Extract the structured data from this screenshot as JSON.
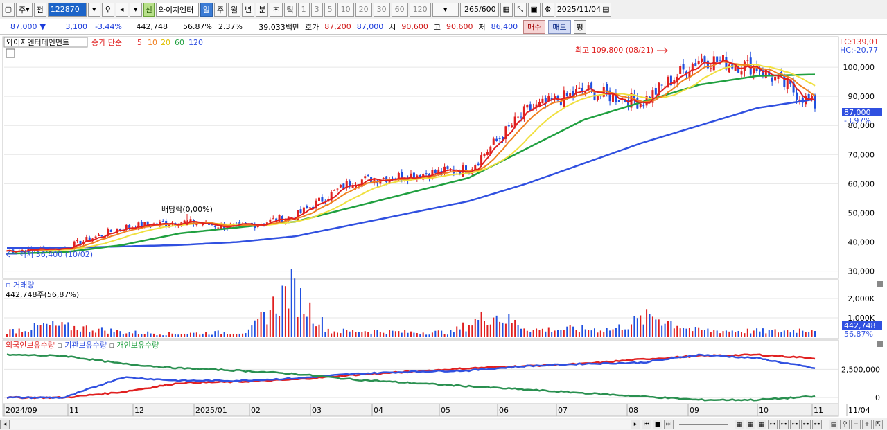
{
  "toolbar": {
    "period_label": "주",
    "prev_label": "전",
    "stock_code": "122870",
    "shin_label": "신",
    "stock_name": "와이지엔터",
    "intervals": [
      "일",
      "주",
      "월",
      "년",
      "분",
      "초",
      "틱"
    ],
    "active_interval": "일",
    "minutes": [
      "1",
      "3",
      "5",
      "10",
      "20",
      "30",
      "60",
      "120"
    ],
    "count_display": "265",
    "count_total": "/600",
    "date": "2025/11/04"
  },
  "quote": {
    "price": "87,000",
    "change": "3,100",
    "change_pct": "-3.44%",
    "volume": "442,748",
    "volume_ratio": "56.87%",
    "turnover_pct": "2.37%",
    "value": "39,033백만",
    "bid_label": "호가",
    "bid": "87,200",
    "ask": "87,000",
    "open_label": "시",
    "open": "90,600",
    "high_label": "고",
    "high": "90,600",
    "low_label": "저",
    "low": "86,400",
    "buy_button": "매수",
    "sell_button": "매도",
    "eval_button": "평"
  },
  "price_panel": {
    "stock_label": "와이지엔터테인먼트",
    "ma_label": "종가 단순",
    "ma_periods": [
      "5",
      "10",
      "20",
      "60",
      "120"
    ],
    "lc_label": "LC:139,01",
    "hc_label": "HC:-20,77",
    "high_annotation": "최고 109,800 (08/21)",
    "low_annotation": "최저 36,400 (10/02)",
    "dividend_annotation": "배당락(0,00%)",
    "current_price_tag": "87,000",
    "current_change_tag": "-3,97%"
  },
  "volume_panel": {
    "title": "거래량",
    "summary": "442,748주(56,87%)",
    "current_tag": "442,748",
    "current_ratio_tag": "56,87%"
  },
  "holding_panel": {
    "series": [
      "외국인보유수량",
      "기관보유수량",
      "개인보유수량"
    ]
  },
  "x_axis_labels": [
    "2024/09",
    "11",
    "12",
    "2025/01",
    "02",
    "03",
    "04",
    "05",
    "06",
    "07",
    "08",
    "09",
    "10",
    "11",
    "11/04"
  ],
  "colors": {
    "ma5": "#e02020",
    "ma10": "#f08020",
    "ma20": "#f0e040",
    "ma60": "#20a040",
    "ma120": "#3050e0",
    "candle_up": "#e02020",
    "candle_down": "#2050e0"
  },
  "chart_data": [
    {
      "type": "line",
      "title": "와이지엔터테인먼트",
      "x": [
        "2024/09",
        "10",
        "11",
        "12",
        "2025/01",
        "02",
        "03",
        "04",
        "05",
        "06",
        "07",
        "08",
        "09",
        "10",
        "11"
      ],
      "ylim": [
        28000,
        110000
      ],
      "y_ticks": [
        "30,000",
        "40,000",
        "50,000",
        "60,000",
        "70,000",
        "80,000",
        "90,000",
        "100,000"
      ],
      "series": [
        {
          "name": "종가",
          "values": [
            37000,
            38000,
            45000,
            47000,
            45000,
            49000,
            61000,
            63000,
            65000,
            85000,
            92000,
            88000,
            103000,
            100000,
            87000
          ]
        },
        {
          "name": "60",
          "values": [
            36000,
            36500,
            39000,
            43000,
            45000,
            47000,
            52000,
            57000,
            62000,
            72000,
            82000,
            88000,
            94000,
            97000,
            97500
          ]
        },
        {
          "name": "120",
          "values": [
            38000,
            38000,
            38500,
            39000,
            40000,
            42000,
            46000,
            50000,
            54000,
            60000,
            67000,
            74000,
            80000,
            86000,
            89000
          ]
        }
      ]
    },
    {
      "type": "bar",
      "title": "거래량",
      "y_ticks": [
        "1,000K",
        "2,000K"
      ],
      "values": [
        300,
        600,
        450,
        250,
        180,
        220,
        280,
        2500,
        300,
        320,
        250,
        260,
        1200,
        380,
        420,
        400,
        1100,
        360,
        330,
        300,
        440
      ]
    },
    {
      "type": "line",
      "title": "외국인보유수량 기관보유수량 개인보유수량",
      "y_ticks": [
        "0",
        "2,500,000"
      ],
      "series": [
        {
          "name": "외국인보유수량",
          "values": [
            0,
            0,
            500000,
            1300000,
            1400000,
            1600000,
            2000000,
            2300000,
            2600000,
            2800000,
            3000000,
            3400000,
            3700000,
            3800000,
            3500000
          ]
        },
        {
          "name": "기관보유수량",
          "values": [
            0,
            0,
            1800000,
            1500000,
            1500000,
            1700000,
            2100000,
            2300000,
            2400000,
            2800000,
            3000000,
            3100000,
            3800000,
            3500000,
            2600000
          ]
        },
        {
          "name": "개인보유수량",
          "values": [
            3800000,
            3700000,
            3000000,
            2600000,
            2400000,
            2100000,
            1600000,
            1300000,
            1000000,
            700000,
            400000,
            100000,
            -200000,
            -200000,
            100000
          ]
        }
      ]
    }
  ]
}
